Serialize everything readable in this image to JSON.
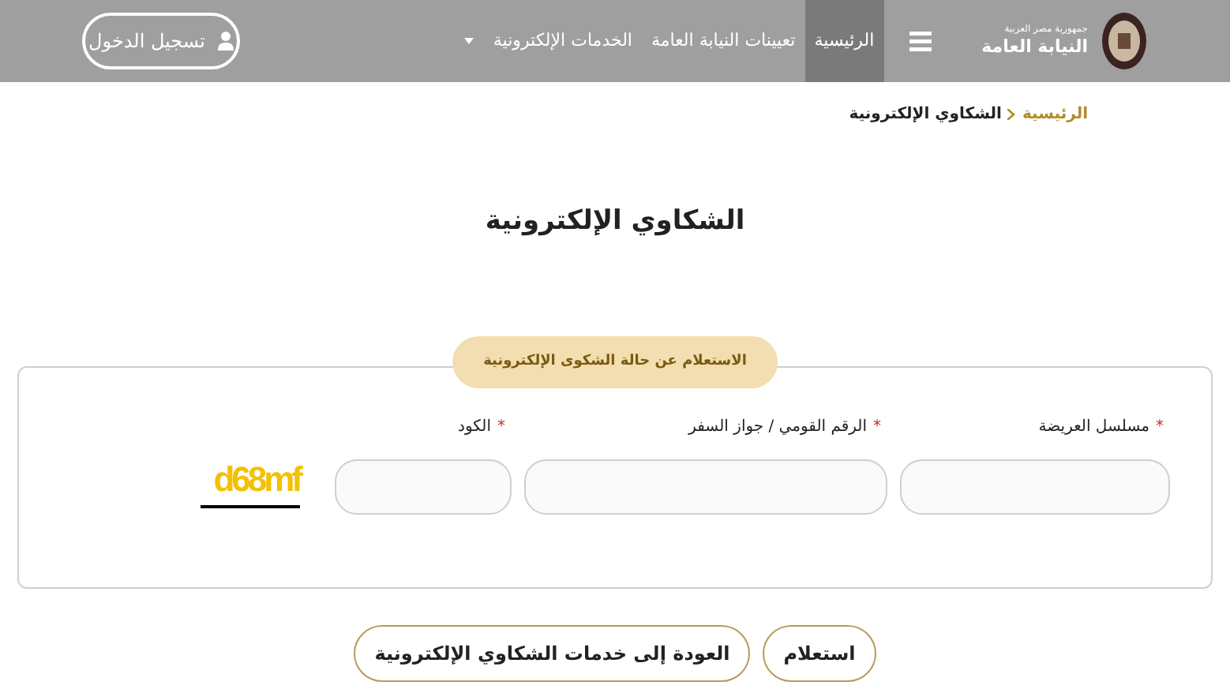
{
  "header": {
    "logo_subtitle": "جمهورية مصر العربية",
    "logo_title": "النيابة العامة",
    "nav": [
      {
        "label": "الرئيسية",
        "selected": true,
        "dropdown": false
      },
      {
        "label": "تعيينات النيابة العامة",
        "selected": false,
        "dropdown": false
      },
      {
        "label": "الخدمات الإلكترونية",
        "selected": false,
        "dropdown": true
      }
    ],
    "login_button": "تسجيل الدخول"
  },
  "breadcrumb": [
    {
      "label": "الرئيسية",
      "link": true
    },
    {
      "label": "الشكاوي الإلكترونية",
      "link": false
    }
  ],
  "page_title": "الشكاوي الإلكترونية",
  "form": {
    "legend": "الاستعلام عن حالة الشكوى الإلكترونية",
    "fields": [
      {
        "label": "مسلسل العريضة",
        "required_mark": "*"
      },
      {
        "label": "الرقم القومي / جواز السفر",
        "required_mark": "*"
      },
      {
        "label": "الكود",
        "required_mark": "*"
      }
    ],
    "captcha": "d68mf"
  },
  "buttons": [
    "استعلام",
    "العودة إلى خدمات الشكاوي الإلكترونية"
  ]
}
